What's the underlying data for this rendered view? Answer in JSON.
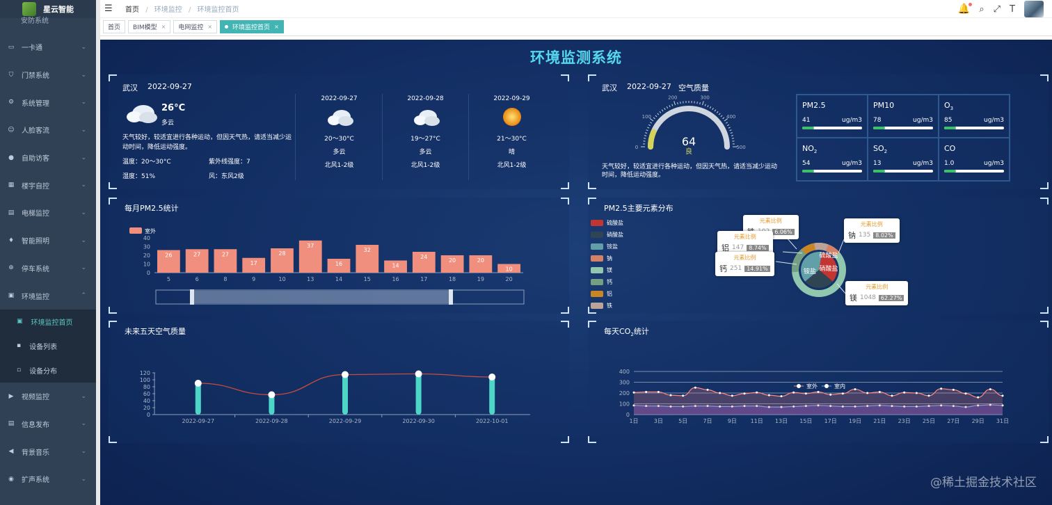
{
  "app": {
    "name": "星云智能"
  },
  "sidebar": {
    "partial_top": "安防系统",
    "items": [
      {
        "label": "一卡通",
        "icon": "card-icon"
      },
      {
        "label": "门禁系统",
        "icon": "shield-icon"
      },
      {
        "label": "系统管理",
        "icon": "gear-icon"
      },
      {
        "label": "人脸客流",
        "icon": "face-icon"
      },
      {
        "label": "自助访客",
        "icon": "user-icon"
      },
      {
        "label": "楼宇自控",
        "icon": "building-icon"
      },
      {
        "label": "电梯监控",
        "icon": "elevator-icon"
      },
      {
        "label": "智能照明",
        "icon": "bulb-icon"
      },
      {
        "label": "停车系统",
        "icon": "parking-icon"
      },
      {
        "label": "环境监控",
        "icon": "monitor-icon"
      }
    ],
    "subitems": [
      {
        "label": "环境监控首页",
        "icon": "monitor-icon"
      },
      {
        "label": "设备列表",
        "icon": "grid-icon"
      },
      {
        "label": "设备分布",
        "icon": "distribution-icon"
      }
    ],
    "items_after": [
      {
        "label": "视频监控",
        "icon": "video-icon"
      },
      {
        "label": "信息发布",
        "icon": "document-icon"
      },
      {
        "label": "背景音乐",
        "icon": "speaker-icon"
      },
      {
        "label": "扩声系统",
        "icon": "broadcast-icon"
      }
    ]
  },
  "breadcrumb": {
    "home": "首页",
    "level1": "环境监控",
    "level2": "环境监控首页"
  },
  "tags": [
    {
      "label": "首页"
    },
    {
      "label": "BIM模型"
    },
    {
      "label": "电网监控"
    },
    {
      "label": "环境监控首页"
    }
  ],
  "dashboard": {
    "title": "环境监测系统",
    "weather": {
      "city": "武汉",
      "date": "2022-09-27",
      "temp": "26°C",
      "condition": "多云",
      "advice": "天气较好，较适宜进行各种运动，但因天气热，请适当减少运动时间，降低运动强度。",
      "temp_range": "温度：20～30°C",
      "uv": "紫外线强度：7",
      "humidity": "湿度：51%",
      "wind": "风：东风2级",
      "forecast": [
        {
          "date": "2022-09-27",
          "range": "20～30°C",
          "cond": "多云",
          "wind": "北风1-2级"
        },
        {
          "date": "2022-09-28",
          "range": "19～27°C",
          "cond": "多云",
          "wind": "北风1-2级"
        },
        {
          "date": "2022-09-29",
          "range": "21～30°C",
          "cond": "晴",
          "wind": "北风1-2级"
        }
      ]
    },
    "air": {
      "city": "武汉",
      "date": "2022-09-27",
      "label": "空气质量",
      "gauge_value": "64",
      "gauge_level": "良",
      "gauge_value_num": 64,
      "gauge_ticks": [
        "0",
        "100",
        "200",
        "300",
        "400",
        "500"
      ],
      "advice": "天气较好，较适宜进行各种运动，但因天气热，请适当减少运动时间，降低运动强度。",
      "pollutants": [
        {
          "name": "PM2.5",
          "value": "41",
          "unit": "ug/m3",
          "level": 0.2
        },
        {
          "name": "PM10",
          "value": "78",
          "unit": "ug/m3",
          "level": 0.2
        },
        {
          "name": "O",
          "sub": "3",
          "value": "85",
          "unit": "ug/m3",
          "level": 0.2
        },
        {
          "name": "NO",
          "sub": "2",
          "value": "54",
          "unit": "ug/m3",
          "level": 0.2
        },
        {
          "name": "SO",
          "sub": "2",
          "value": "13",
          "unit": "ug/m3",
          "level": 0.2
        },
        {
          "name": "CO",
          "sub": "",
          "value": "1.0",
          "unit": "ug/m3",
          "level": 0.2
        }
      ]
    },
    "pm25_panel": {
      "title": "每月PM2.5统计"
    },
    "elements_panel": {
      "title": "PM2.5主要元素分布"
    },
    "forecast_panel": {
      "title": "未来五天空气质量"
    },
    "co2_panel": {
      "title": "每天CO",
      "title_sub": "2",
      "title_tail": "统计"
    }
  },
  "watermark": "@稀土掘金技术社区",
  "chart_data": [
    {
      "type": "bar",
      "title": "每月PM2.5统计",
      "series": [
        {
          "name": "室外",
          "values": [
            26,
            27,
            27,
            17,
            28,
            37,
            16,
            32,
            14,
            24,
            20,
            20,
            10
          ]
        }
      ],
      "categories": [
        "5",
        "6",
        "8",
        "9",
        "10",
        "13",
        "14",
        "15",
        "16",
        "17",
        "18",
        "19",
        "20"
      ],
      "yticks": [
        "0",
        "10",
        "20",
        "30",
        "40"
      ],
      "ylim": [
        0,
        40
      ],
      "color": "#f08f7e"
    },
    {
      "type": "pie",
      "title": "PM2.5主要元素分布",
      "legend": [
        "硫酸盐",
        "硝酸盐",
        "铵盐",
        "钠",
        "镁",
        "钙",
        "铝",
        "铁"
      ],
      "colors": [
        "#c23531",
        "#2f4554",
        "#61a0a8",
        "#d48265",
        "#91c7ae",
        "#749f83",
        "#ca8622",
        "#bda29a"
      ],
      "ring_labels": [
        "硫酸盐",
        "硝酸盐",
        "铵盐"
      ],
      "tooltips": [
        {
          "title": "元素比例",
          "name": "铁",
          "value": "102",
          "percent": "6.06%"
        },
        {
          "title": "元素比例",
          "name": "铝",
          "value": "147",
          "percent": "8.74%"
        },
        {
          "title": "元素比例",
          "name": "钙",
          "value": "251",
          "percent": "14.91%"
        },
        {
          "title": "元素比例",
          "name": "钠",
          "value": "135",
          "percent": "8.02%"
        },
        {
          "title": "元素比例",
          "name": "镁",
          "value": "1048",
          "percent": "62.27%"
        }
      ]
    },
    {
      "type": "line",
      "title": "未来五天空气质量",
      "categories": [
        "2022-09-27",
        "2022-09-28",
        "2022-09-29",
        "2022-09-30",
        "2022-10-01"
      ],
      "values": [
        90,
        57,
        115,
        117,
        108
      ],
      "yticks": [
        "0",
        "20",
        "40",
        "60",
        "80",
        "100",
        "120"
      ],
      "ylim": [
        0,
        120
      ]
    },
    {
      "type": "line",
      "title": "每天CO2统计",
      "legend": [
        "室外",
        "室内"
      ],
      "categories": [
        "1日",
        "3日",
        "5日",
        "7日",
        "9日",
        "11日",
        "13日",
        "15日",
        "17日",
        "19日",
        "21日",
        "23日",
        "25日",
        "27日",
        "29日",
        "31日"
      ],
      "yticks": [
        "0",
        "100",
        "200",
        "300",
        "400"
      ],
      "ylim": [
        0,
        400
      ],
      "series": [
        {
          "name": "室外",
          "values": [
            205,
            210,
            210,
            180,
            175,
            250,
            230,
            200,
            175,
            195,
            205,
            180,
            170,
            205,
            195,
            210,
            185,
            195,
            235,
            200,
            210,
            175,
            205,
            200,
            175,
            240,
            230,
            195,
            160,
            235,
            175
          ]
        },
        {
          "name": "室内",
          "values": [
            85,
            80,
            80,
            75,
            75,
            80,
            80,
            75,
            75,
            80,
            80,
            70,
            70,
            75,
            80,
            85,
            80,
            75,
            75,
            80,
            85,
            80,
            75,
            75,
            80,
            85,
            80,
            70,
            85,
            90,
            85
          ]
        }
      ]
    }
  ]
}
